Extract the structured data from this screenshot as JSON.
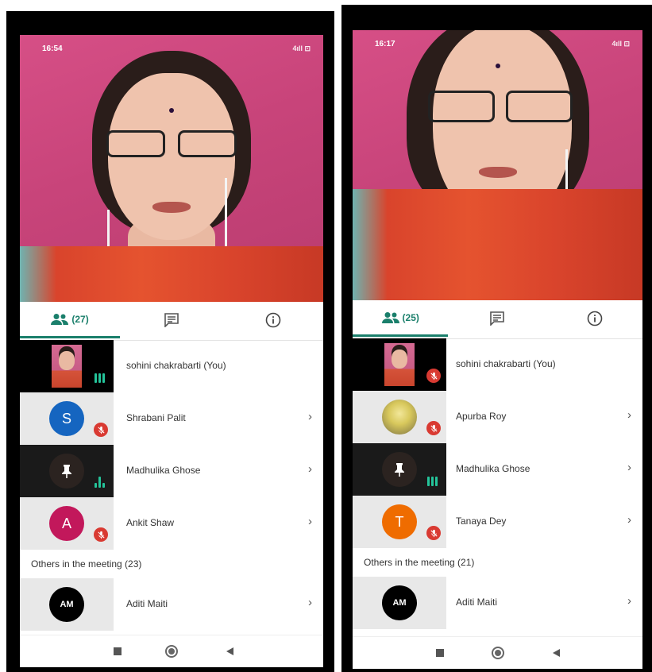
{
  "phones": [
    {
      "status": {
        "time": "16:54",
        "icons_text": "4ıll ⊡"
      },
      "tabs": {
        "people_count": "(27)"
      },
      "participants": [
        {
          "name": "sohini chakrabarti (You)",
          "kind": "self",
          "audio": "speaking"
        },
        {
          "name": "Shrabani Palit",
          "kind": "initial",
          "initial": "S",
          "color": "#1565c0",
          "audio": "muted"
        },
        {
          "name": "Madhulika Ghose",
          "kind": "pinned",
          "audio": "speaking"
        },
        {
          "name": "Ankit Shaw",
          "kind": "initial",
          "initial": "A",
          "color": "#c2185b",
          "audio": "muted"
        }
      ],
      "others_header": "Others in the meeting (23)",
      "others_first": {
        "initial": "AM",
        "name": "Aditi Maiti"
      }
    },
    {
      "status": {
        "time": "16:17",
        "icons_text": "4ıll ⊡"
      },
      "tabs": {
        "people_count": "(25)"
      },
      "participants": [
        {
          "name": "sohini chakrabarti (You)",
          "kind": "self",
          "audio": "muted"
        },
        {
          "name": "Apurba Roy",
          "kind": "photo",
          "audio": "muted"
        },
        {
          "name": "Madhulika Ghose",
          "kind": "pinned",
          "audio": "speaking"
        },
        {
          "name": "Tanaya Dey",
          "kind": "initial",
          "initial": "T",
          "color": "#ef6c00",
          "audio": "muted"
        }
      ],
      "others_header": "Others in the meeting (21)",
      "others_first": {
        "initial": "AM",
        "name": "Aditi Maiti"
      }
    }
  ],
  "colors": {
    "accent": "#1a7f6b",
    "mute_red": "#d93a32",
    "level_green": "#24c49a"
  },
  "icons": {
    "people": "people-icon",
    "chat": "chat-icon",
    "info": "info-icon",
    "chevron": "chevron-right-icon",
    "mute": "mic-off-icon",
    "pin": "pin-icon"
  }
}
